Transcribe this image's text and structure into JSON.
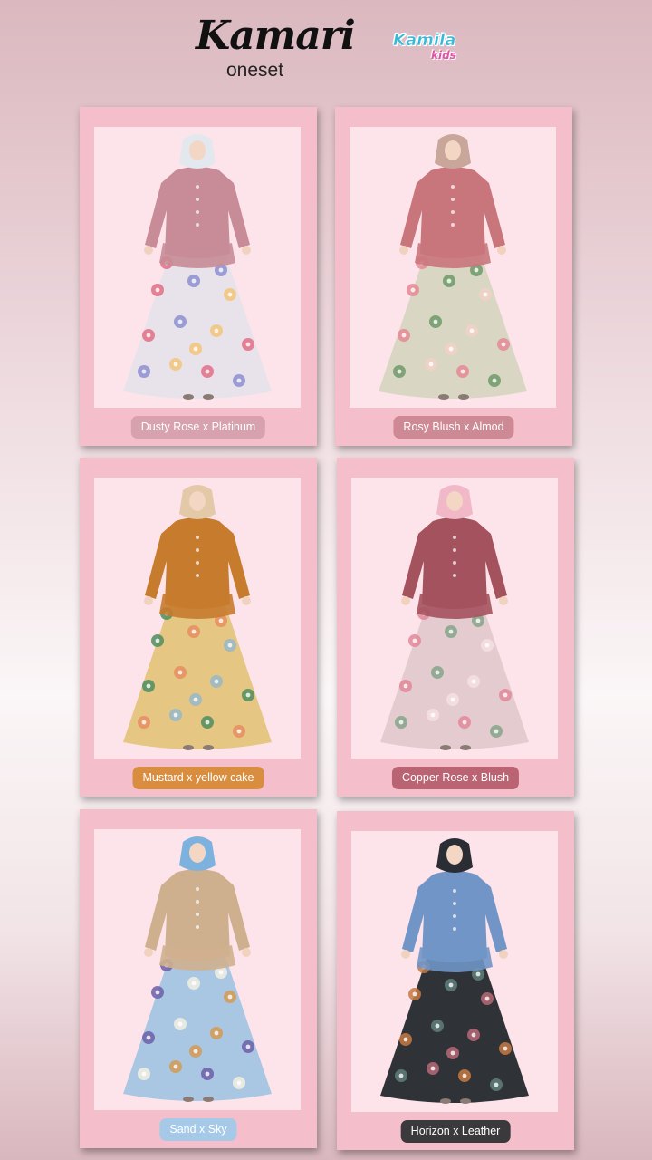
{
  "header": {
    "title": "Kamari",
    "subtitle": "oneset",
    "logo_main": "Kamila",
    "logo_sub": "kids"
  },
  "products": [
    {
      "label": "Dusty Rose x Platinum",
      "label_bg": "#d7a2ad",
      "label_fg": "#ffffff",
      "top_color": "#c78c97",
      "skirt_color": "#e8e2ea",
      "hijab_color": "#e3e7ee",
      "flower_colors": [
        "#e36f86",
        "#8d8fd0",
        "#f2c47a"
      ]
    },
    {
      "label": "Rosy Blush x Almod",
      "label_bg": "#cd8994",
      "label_fg": "#ffffff",
      "top_color": "#c9757c",
      "skirt_color": "#d9d6c3",
      "hijab_color": "#c8a79a",
      "flower_colors": [
        "#e58a95",
        "#6e9a6a",
        "#f0d2c5"
      ]
    },
    {
      "label": "Mustard x yellow cake",
      "label_bg": "#d88d3f",
      "label_fg": "#ffffff",
      "top_color": "#c67b2d",
      "skirt_color": "#e6c683",
      "hijab_color": "#e3c9a7",
      "flower_colors": [
        "#4e8d5f",
        "#e68d62",
        "#96b7c9"
      ]
    },
    {
      "label": "Copper Rose x Blush",
      "label_bg": "#b96373",
      "label_fg": "#ffffff",
      "top_color": "#a4525d",
      "skirt_color": "#e4cbd0",
      "hijab_color": "#f1b8c8",
      "flower_colors": [
        "#e08a9a",
        "#86a58b",
        "#f6e1e4"
      ]
    },
    {
      "label": "Sand x Sky",
      "label_bg": "#a6c9e8",
      "label_fg": "#ffffff",
      "top_color": "#cfb08e",
      "skirt_color": "#a9c7e3",
      "hijab_color": "#7eb2de",
      "flower_colors": [
        "#6c5ea8",
        "#f2efe3",
        "#d49a52"
      ]
    },
    {
      "label": "Horizon x Leather",
      "label_bg": "#3a3a3c",
      "label_fg": "#ffffff",
      "top_color": "#7095c6",
      "skirt_color": "#2f3236",
      "hijab_color": "#2a2d33",
      "flower_colors": [
        "#c67a42",
        "#5f7f7a",
        "#b76a78"
      ]
    }
  ]
}
